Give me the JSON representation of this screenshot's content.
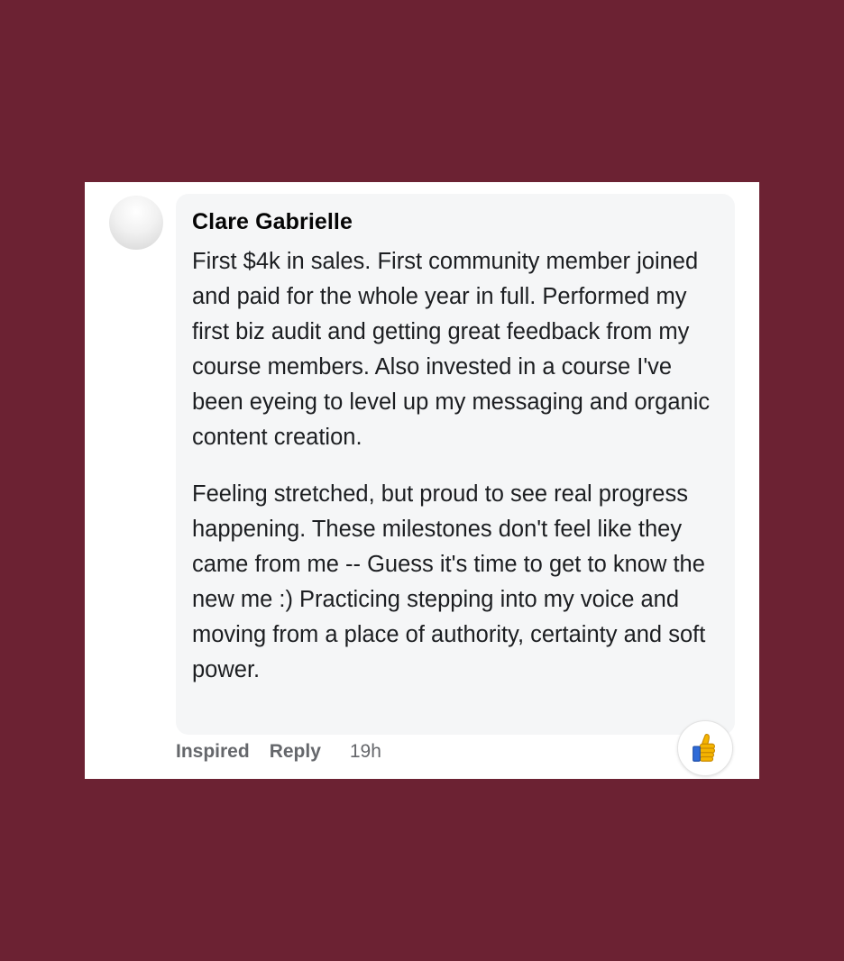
{
  "comment": {
    "author": "Clare Gabrielle",
    "paragraphs": [
      "First $4k in sales. First community member joined and paid for the whole year in full. Performed my first biz audit and getting great feedback from my course members. Also invested in a course I've been eyeing to level up my messaging and organic content creation.",
      "Feeling stretched, but proud to see real progress happening. These milestones don't feel like they came from me -- Guess it's time to get to know the new me :) Practicing stepping into my voice and moving from a place of authority, certainty and soft power."
    ],
    "actions": {
      "reaction_label": "Inspired",
      "reply_label": "Reply",
      "timestamp": "19h"
    },
    "reaction_icon": "thumbs-up-icon"
  },
  "colors": {
    "background": "#6c2233",
    "card": "#ffffff",
    "bubble": "#f5f6f7",
    "thumb": "#f4b400"
  }
}
